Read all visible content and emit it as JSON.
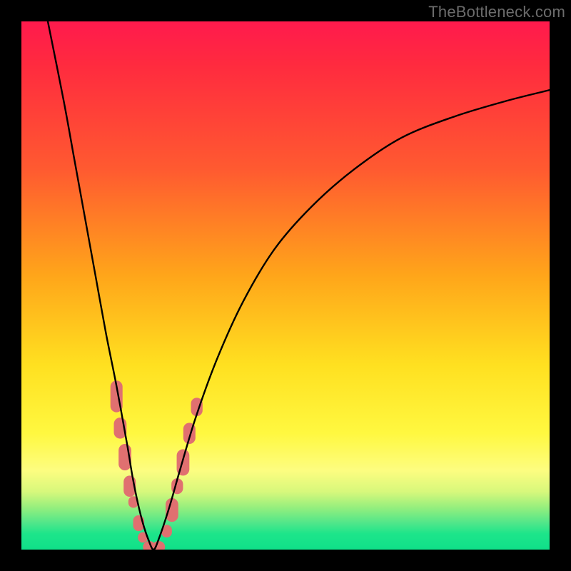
{
  "watermark": "TheBottleneck.com",
  "chart_data": {
    "type": "line",
    "title": "",
    "xlabel": "",
    "ylabel": "",
    "xlim": [
      0,
      100
    ],
    "ylim": [
      0,
      100
    ],
    "grid": false,
    "legend": false,
    "annotations": [],
    "series": [
      {
        "name": "bottleneck-curve",
        "color": "#000000",
        "x": [
          5,
          8,
          10,
          12,
          14,
          16,
          18,
          20,
          21,
          22,
          23,
          24,
          25,
          26,
          28,
          30,
          33,
          37,
          42,
          48,
          55,
          63,
          72,
          82,
          92,
          100
        ],
        "y": [
          100,
          85,
          74,
          63,
          52,
          41,
          31,
          20,
          14,
          9,
          5,
          2,
          0,
          2,
          8,
          15,
          25,
          36,
          47,
          57,
          65,
          72,
          78,
          82,
          85,
          87
        ]
      }
    ],
    "markers": [
      {
        "name": "highlight-dots",
        "color": "#e07070",
        "shape": "rounded-pill",
        "points": [
          {
            "x": 18,
            "y": 29,
            "w": 2.3,
            "h": 6.0
          },
          {
            "x": 18.7,
            "y": 23,
            "w": 2.4,
            "h": 4.0
          },
          {
            "x": 19.6,
            "y": 17.5,
            "w": 2.4,
            "h": 5.0
          },
          {
            "x": 20.5,
            "y": 12,
            "w": 2.3,
            "h": 4.0
          },
          {
            "x": 21.2,
            "y": 9,
            "w": 1.9,
            "h": 2.2
          },
          {
            "x": 22.2,
            "y": 5,
            "w": 2.1,
            "h": 3.0
          },
          {
            "x": 23.0,
            "y": 2.3,
            "w": 1.9,
            "h": 2.0
          },
          {
            "x": 24.2,
            "y": 0.5,
            "w": 2.4,
            "h": 2.2
          },
          {
            "x": 26.0,
            "y": 0.5,
            "w": 2.4,
            "h": 2.2
          },
          {
            "x": 27.5,
            "y": 3.5,
            "w": 2.0,
            "h": 2.4
          },
          {
            "x": 28.5,
            "y": 7.5,
            "w": 2.4,
            "h": 4.5
          },
          {
            "x": 29.5,
            "y": 12.0,
            "w": 2.2,
            "h": 3.0
          },
          {
            "x": 30.6,
            "y": 16.5,
            "w": 2.4,
            "h": 5.0
          },
          {
            "x": 31.8,
            "y": 22.0,
            "w": 2.3,
            "h": 4.0
          },
          {
            "x": 33.2,
            "y": 27.0,
            "w": 2.2,
            "h": 3.5
          }
        ]
      }
    ],
    "background_gradient": {
      "direction": "top-to-bottom",
      "stops": [
        {
          "pos": 0,
          "color": "#ff1a4d"
        },
        {
          "pos": 28,
          "color": "#ff5a30"
        },
        {
          "pos": 48,
          "color": "#ffa51a"
        },
        {
          "pos": 78,
          "color": "#fff840"
        },
        {
          "pos": 92,
          "color": "#96ef7d"
        },
        {
          "pos": 100,
          "color": "#10e089"
        }
      ]
    }
  }
}
